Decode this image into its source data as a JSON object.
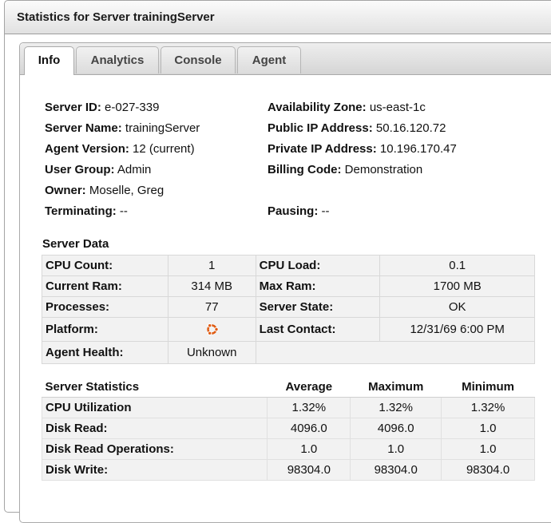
{
  "window": {
    "title": "Statistics for Server trainingServer"
  },
  "tabs": [
    {
      "label": "Info",
      "active": true
    },
    {
      "label": "Analytics",
      "active": false
    },
    {
      "label": "Console",
      "active": false
    },
    {
      "label": "Agent",
      "active": false
    }
  ],
  "info": {
    "server_id": {
      "label": "Server ID:",
      "value": "e-027-339"
    },
    "server_name": {
      "label": "Server Name:",
      "value": "trainingServer"
    },
    "agent_version": {
      "label": "Agent Version:",
      "value": "12 (current)"
    },
    "user_group": {
      "label": "User Group:",
      "value": "Admin"
    },
    "owner": {
      "label": "Owner:",
      "value": "Moselle, Greg"
    },
    "terminating": {
      "label": "Terminating:",
      "value": "--"
    },
    "availability_zone": {
      "label": "Availability Zone:",
      "value": "us-east-1c"
    },
    "public_ip": {
      "label": "Public IP Address:",
      "value": "50.16.120.72"
    },
    "private_ip": {
      "label": "Private IP Address:",
      "value": "10.196.170.47"
    },
    "billing_code": {
      "label": "Billing Code:",
      "value": "Demonstration"
    },
    "pausing": {
      "label": "Pausing:",
      "value": "--"
    }
  },
  "server_data": {
    "title": "Server Data",
    "rows": [
      {
        "l1": "CPU Count:",
        "v1": "1",
        "l2": "CPU Load:",
        "v2": "0.1"
      },
      {
        "l1": "Current Ram:",
        "v1": "314 MB",
        "l2": "Max Ram:",
        "v2": "1700 MB"
      },
      {
        "l1": "Processes:",
        "v1": "77",
        "l2": "Server State:",
        "v2": "OK"
      },
      {
        "l1": "Platform:",
        "v1": "",
        "l2": "Last Contact:",
        "v2": "12/31/69 6:00 PM"
      },
      {
        "l1": "Agent Health:",
        "v1": "Unknown",
        "l2": "",
        "v2": ""
      }
    ],
    "platform_icon": "ubuntu-logo-icon"
  },
  "server_statistics": {
    "title": "Server Statistics",
    "columns": [
      "Average",
      "Maximum",
      "Minimum"
    ],
    "rows": [
      {
        "label": "CPU Utilization",
        "avg": "1.32%",
        "max": "1.32%",
        "min": "1.32%"
      },
      {
        "label": "Disk Read:",
        "avg": "4096.0",
        "max": "4096.0",
        "min": "1.0"
      },
      {
        "label": "Disk Read Operations:",
        "avg": "1.0",
        "max": "1.0",
        "min": "1.0"
      },
      {
        "label": "Disk Write:",
        "avg": "98304.0",
        "max": "98304.0",
        "min": "98304.0"
      }
    ]
  }
}
